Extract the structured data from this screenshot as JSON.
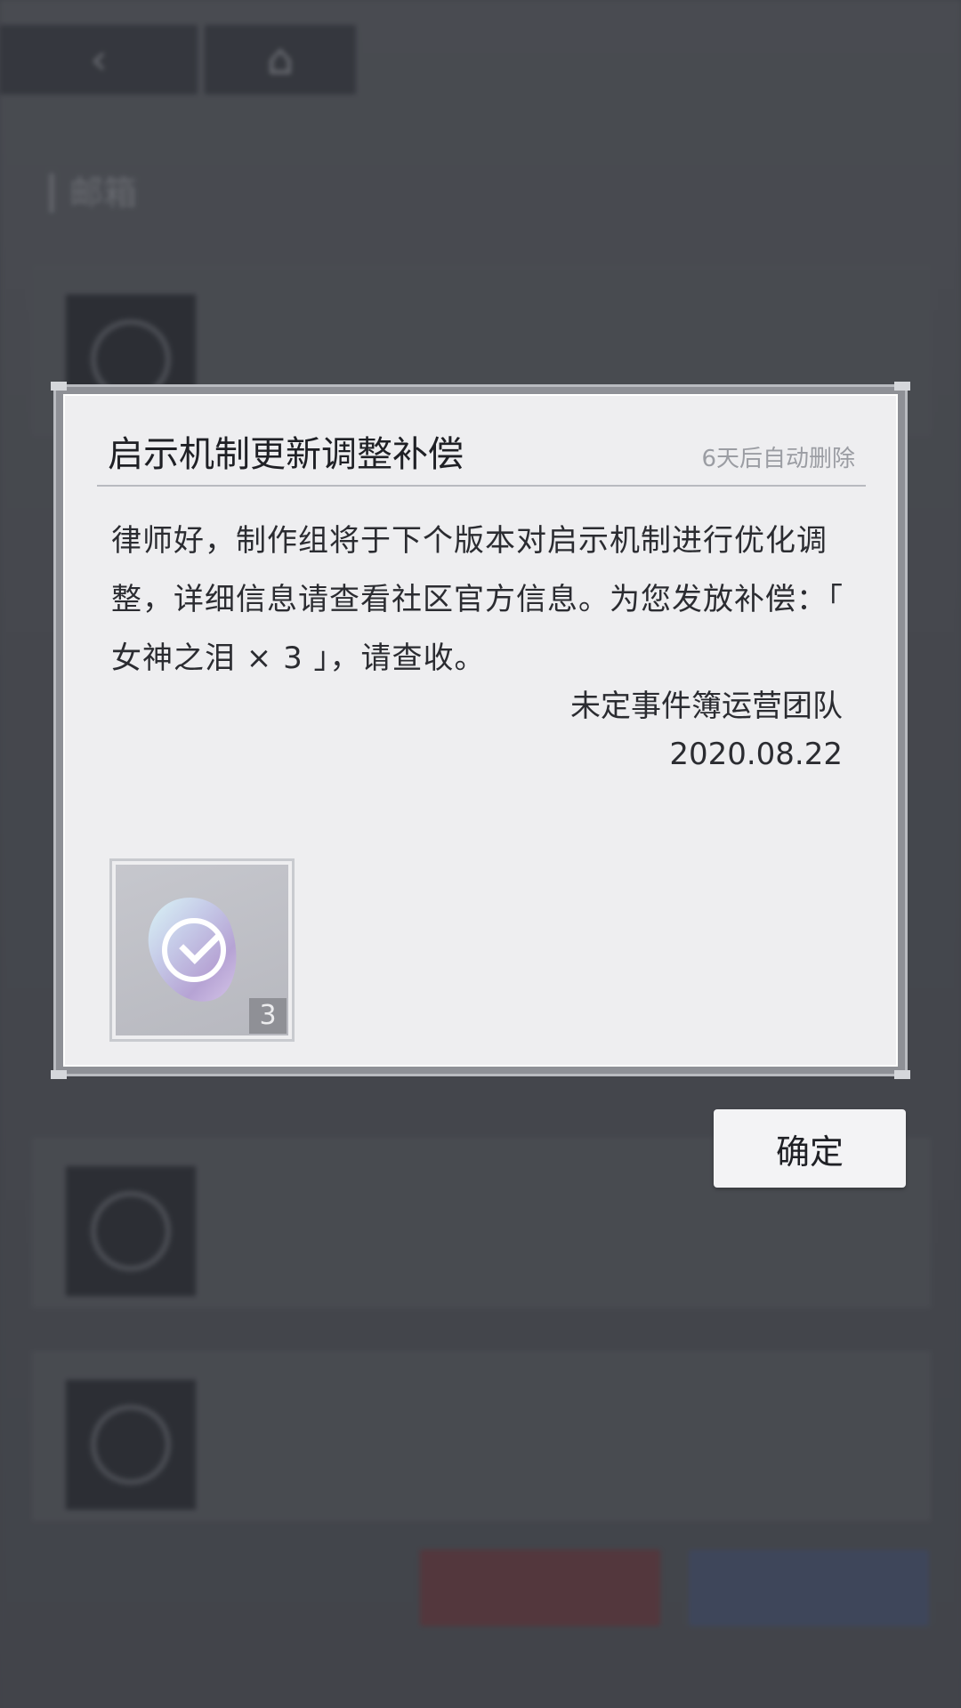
{
  "background": {
    "section_title": "邮箱",
    "mails": [
      {
        "subject": "",
        "preview": "",
        "expiry": ""
      },
      {
        "subject": "",
        "preview": "",
        "expiry": ""
      },
      {
        "subject": "",
        "preview": "",
        "expiry": ""
      }
    ],
    "bottom": {
      "mail_count": "",
      "hint": "",
      "delete_label": "",
      "claim_label": ""
    }
  },
  "modal": {
    "title": "启示机制更新调整补偿",
    "expiry": "6天后自动删除",
    "body": "律师好，制作组将于下个版本对启示机制进行优化调整，详细信息请查看社区官方信息。为您发放补偿：「 女神之泪 × 3 」，请查收。",
    "signature_team": "未定事件簿运营团队",
    "signature_date": "2020.08.22",
    "reward": {
      "icon": "goddess-tear-gem-icon",
      "count": "3"
    }
  },
  "confirm_label": "确定",
  "colors": {
    "modal_bg": "#eeeef0",
    "overlay_bg": "#4f5157",
    "button_bg": "#f3f3f5",
    "text_primary": "#1f2025",
    "text_muted": "#9b9da3"
  }
}
